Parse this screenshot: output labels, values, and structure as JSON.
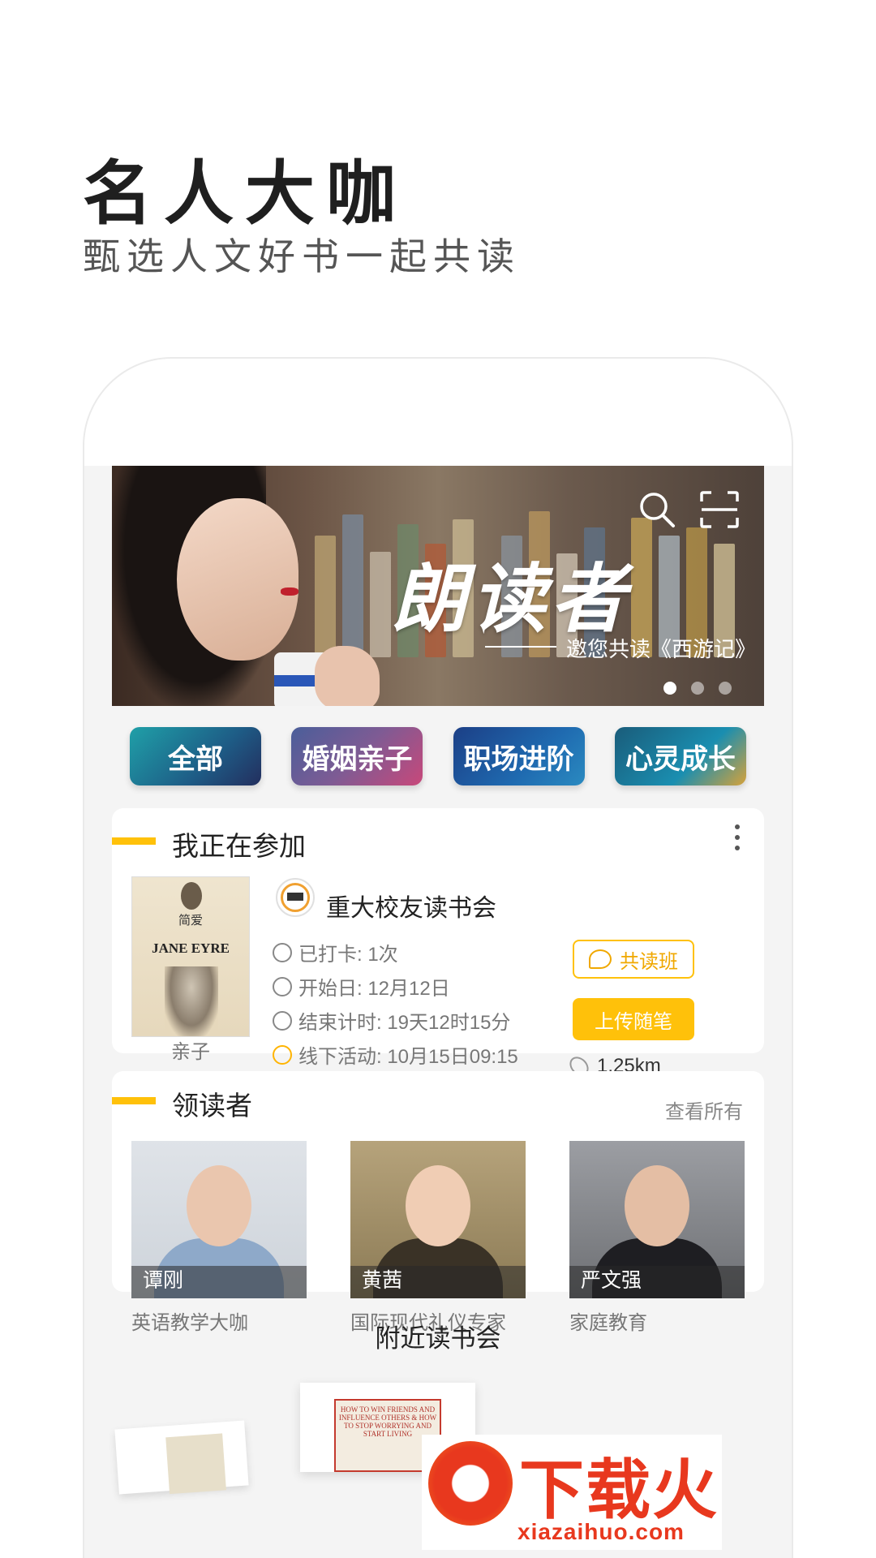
{
  "promo": {
    "title": "名人大咖",
    "subtitle": "甄选人文好书一起共读"
  },
  "banner": {
    "title": "朗读者",
    "subtitle": "邀您共读《西游记》",
    "search_icon": "search-icon",
    "scan_icon": "scan-icon",
    "dots_count": 3,
    "active_dot": 1
  },
  "categories": [
    {
      "label": "全部"
    },
    {
      "label": "婚姻亲子"
    },
    {
      "label": "职场进阶"
    },
    {
      "label": "心灵成长"
    }
  ],
  "participating": {
    "section_title": "我正在参加",
    "book": {
      "cn_title": "简爱",
      "en_title": "JANE EYRE",
      "category": "亲子"
    },
    "club_name": "重大校友读书会",
    "checkin": "已打卡: 1次",
    "start_date": "开始日: 12月12日",
    "countdown": "结束计时: 19天12时15分",
    "offline": "线下活动: 10月15日09:15",
    "join_class_button": "共读班",
    "upload_button": "上传随笔",
    "distance": "1.25km"
  },
  "leaders": {
    "section_title": "领读者",
    "see_all": "查看所有",
    "items": [
      {
        "name": "谭刚",
        "role": "英语教学大咖"
      },
      {
        "name": "黄茜",
        "role": "国际现代礼仪专家"
      },
      {
        "name": "严文强",
        "role": "家庭教育"
      }
    ]
  },
  "nearby": {
    "section_title": "附近读书会",
    "book_cover_text": "HOW TO WIN FRIENDS AND INFLUENCE OTHERS & HOW TO STOP WORRYING AND START LIVING"
  },
  "watermark": {
    "text": "下载火",
    "url": "xiazaihuo.com"
  },
  "colors": {
    "accent": "#ffc10a",
    "watermark": "#e8381e"
  }
}
